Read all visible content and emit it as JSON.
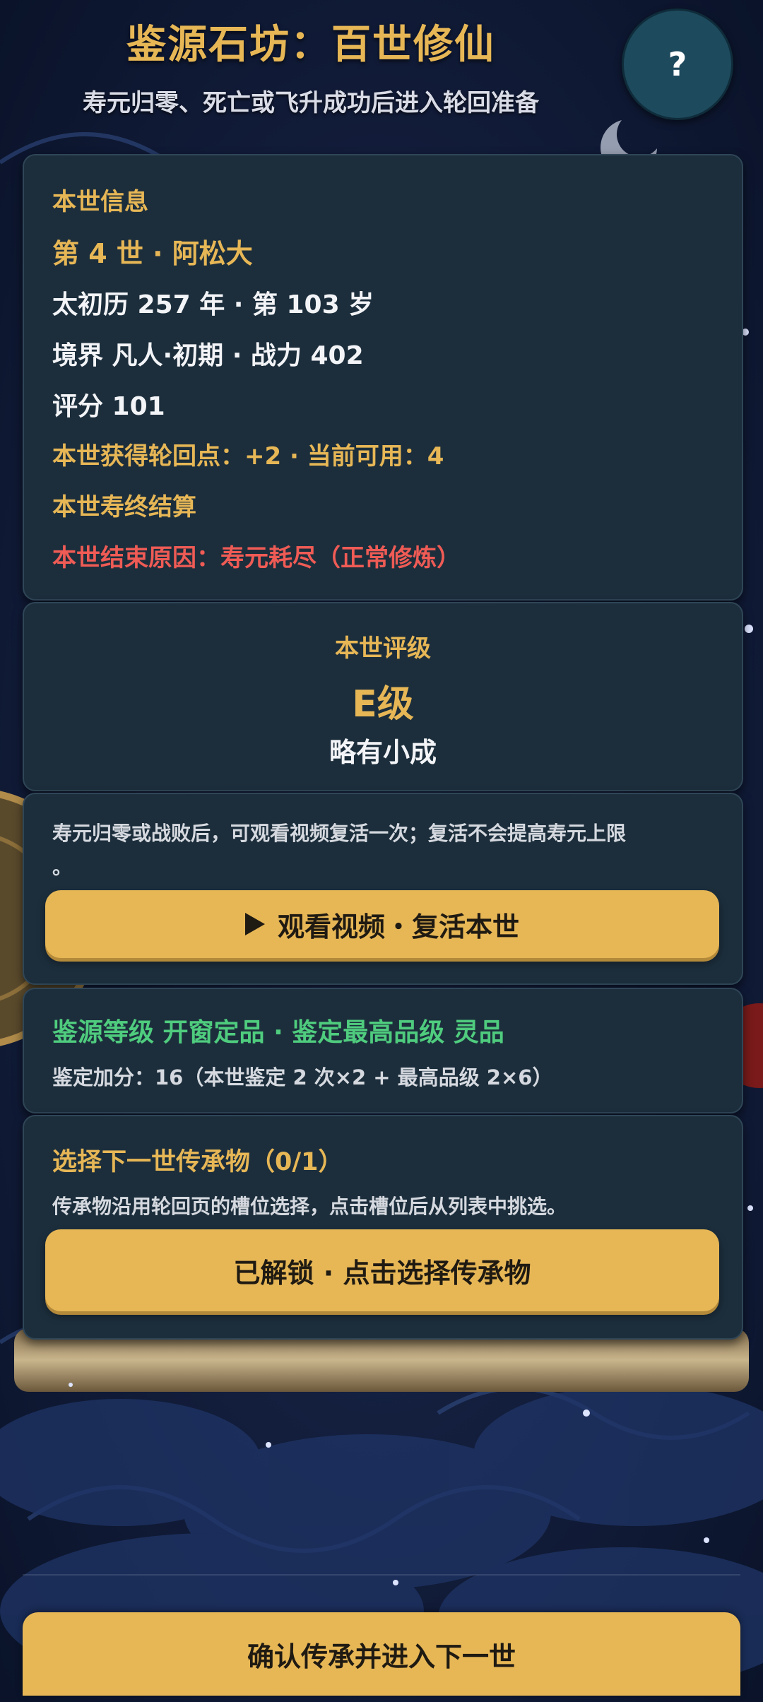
{
  "header": {
    "title": "鉴源石坊：百世修仙",
    "subtitle": "寿元归零、死亡或飞升成功后进入轮回准备",
    "help_label": "?"
  },
  "life_info": {
    "heading": "本世信息",
    "generation_line": "第 4 世 · 阿松大",
    "age_line": "太初历 257 年 · 第 103 岁",
    "realm_line": "境界 凡人·初期 · 战力 402",
    "score_line": "评分 101",
    "points_line": "本世获得轮回点：+2 · 当前可用：4",
    "settlement_heading": "本世寿终结算",
    "end_reason": "本世结束原因：寿元耗尽（正常修炼）"
  },
  "rating": {
    "heading": "本世评级",
    "grade": "E级",
    "comment": "略有小成"
  },
  "revive": {
    "notice_line1": "寿元归零或战败后，可观看视频复活一次；复活不会提高寿元上限",
    "notice_line2": "。",
    "button_label": "观看视频・复活本世"
  },
  "appraisal": {
    "level_line": "鉴源等级 开窗定品 · 鉴定最高品级 灵品",
    "bonus_line": "鉴定加分：16（本世鉴定 2 次×2 + 最高品级 2×6）"
  },
  "inheritance": {
    "heading": "选择下一世传承物（0/1）",
    "hint": "传承物沿用轮回页的槽位选择，点击槽位后从列表中挑选。",
    "button_label": "已解锁 · 点击选择传承物"
  },
  "confirm_button": "确认传承并进入下一世",
  "colors": {
    "accent_gold": "#e7b756",
    "card_bg": "#1c2e3c",
    "danger_red": "#ef5b55",
    "success_green": "#4fcc7e"
  },
  "icons": {
    "help": "question-mark-icon",
    "play": "play-icon"
  }
}
